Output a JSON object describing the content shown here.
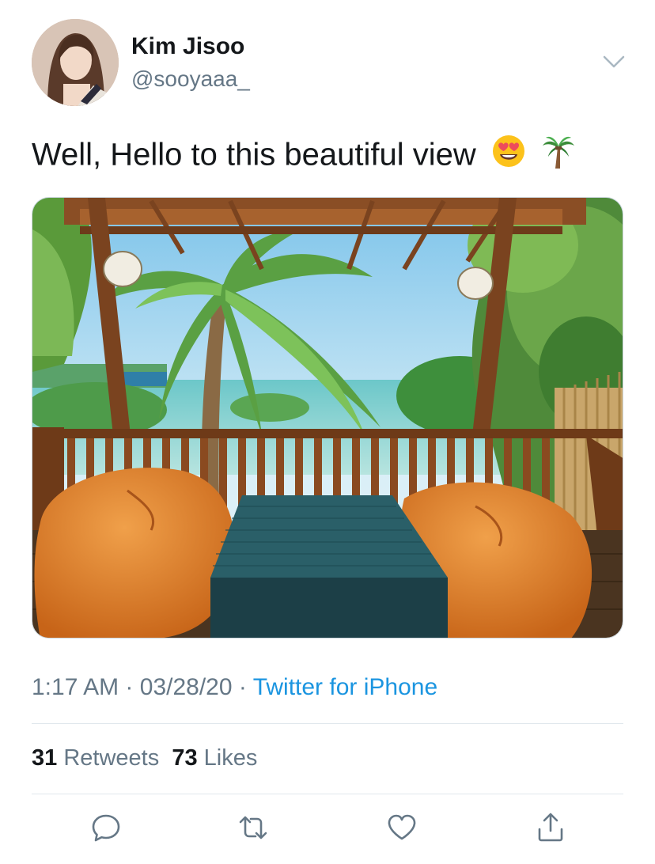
{
  "author": {
    "display_name": "Kim Jisoo",
    "handle": "@sooyaaa_"
  },
  "tweet": {
    "text": "Well, Hello to this beautiful view",
    "emojis": [
      "heart-eyes-emoji",
      "palm-tree-emoji"
    ]
  },
  "meta": {
    "time": "1:17 AM",
    "separator": "·",
    "date": "03/28/20",
    "source": "Twitter for iPhone"
  },
  "stats": {
    "retweets_count": "31",
    "retweets_label": "Retweets",
    "likes_count": "73",
    "likes_label": "Likes"
  },
  "icons": {
    "menu": "chevron-down-icon",
    "reply": "reply-icon",
    "retweet": "retweet-icon",
    "like": "heart-icon",
    "share": "share-icon"
  },
  "colors": {
    "text": "#14171a",
    "secondary": "#657786",
    "link": "#1b95e0",
    "divider": "#e1e8ed"
  }
}
